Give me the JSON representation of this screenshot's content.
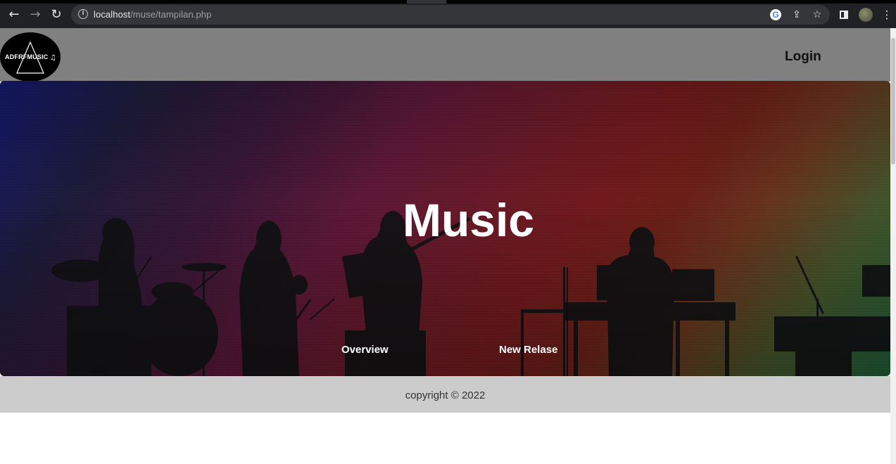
{
  "browser": {
    "url_host": "localhost",
    "url_path": "/muse/tampilan.php",
    "back_icon": "arrow-left-icon",
    "forward_icon": "arrow-right-icon",
    "reload_icon": "reload-icon"
  },
  "site": {
    "logo_text": "ADFRFMUSIC",
    "login_label": "Login"
  },
  "hero": {
    "title": "Music",
    "links": [
      {
        "label": "Overview"
      },
      {
        "label": "New Relase"
      }
    ]
  },
  "footer": {
    "copyright": "copyright © 2022"
  },
  "colors": {
    "navbar": "#808080",
    "footer": "#cccccc",
    "hero_text": "#ffffff"
  }
}
